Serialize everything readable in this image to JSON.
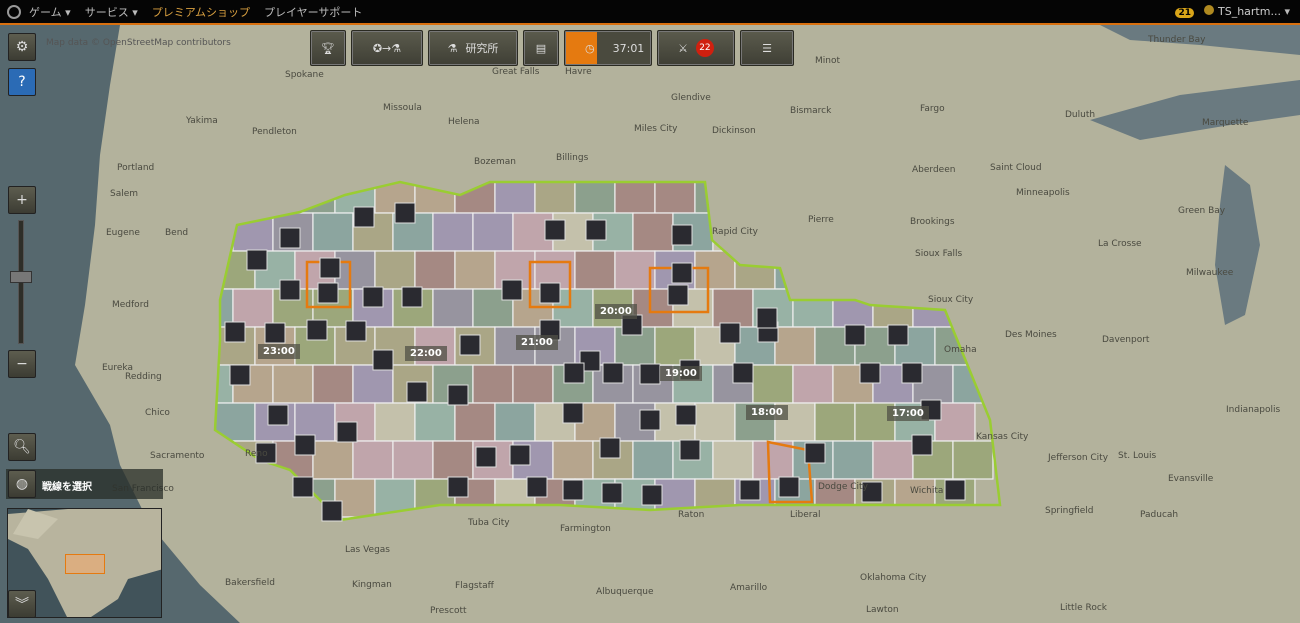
{
  "topbar": {
    "nav": [
      "ゲーム",
      "サービス",
      "プレミアムショップ",
      "プレイヤーサポート"
    ],
    "notifications": "21",
    "username": "TS_hartm..."
  },
  "attribution": "Map data © OpenStreetMap contributors",
  "toolbar": {
    "research_label": "研究所",
    "timer": "37:01",
    "battles_count": "22"
  },
  "left": {
    "front_label": "戦線を選択"
  },
  "timers": [
    "23:00",
    "22:00",
    "21:00",
    "20:00",
    "19:00",
    "18:00",
    "17:00"
  ],
  "cities": [
    "Spokane",
    "Missoula",
    "Helena",
    "Great Falls",
    "Havre",
    "Minot",
    "Bismarck",
    "Fargo",
    "Yakima",
    "Portland",
    "Salem",
    "Eugene",
    "Bend",
    "Pendleton",
    "Billings",
    "Bozeman",
    "Miles City",
    "Glendive",
    "Dickinson",
    "Aberdeen",
    "Saint Cloud",
    "Minneapolis",
    "Duluth",
    "Brookings",
    "Sioux Falls",
    "Rapid City",
    "Pierre",
    "Sioux City",
    "Des Moines",
    "Omaha",
    "Davenport",
    "Medford",
    "Eureka",
    "Redding",
    "Chico",
    "Reno",
    "Sacramento",
    "San Francisco",
    "Las Vegas",
    "Flagstaff",
    "Prescott",
    "Albuquerque",
    "Farmington",
    "Amarillo",
    "Oklahoma City",
    "Wichita",
    "Springfield",
    "St. Louis",
    "Kansas City",
    "Jefferson City",
    "Little Rock",
    "Lawton",
    "Bakersfield",
    "Green Bay",
    "Milwaukee",
    "Thunder Bay",
    "Marquette",
    "La Crosse",
    "Evansville",
    "Indianapolis",
    "Paducah",
    "Raton",
    "Liberal",
    "Dodge City",
    "Tuba City",
    "Kingman"
  ],
  "colors": {
    "accent": "#e57a10",
    "front_border": "#9acd32",
    "help": "#2b6bb5"
  }
}
